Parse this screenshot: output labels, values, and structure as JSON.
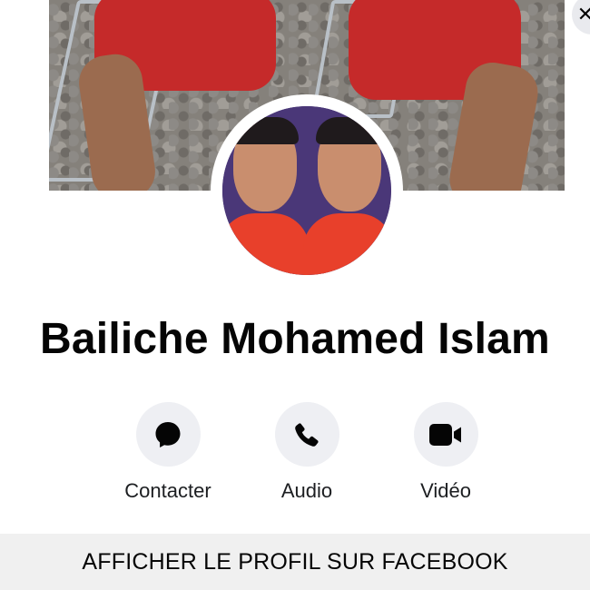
{
  "profile": {
    "name": "Bailiche Mohamed Islam"
  },
  "actions": {
    "contact_label": "Contacter",
    "audio_label": "Audio",
    "video_label": "Vidéo"
  },
  "footer": {
    "view_profile_label": "AFFICHER LE PROFIL SUR FACEBOOK"
  },
  "icons": {
    "contact": "messenger-bubble-icon",
    "audio": "phone-icon",
    "video": "video-camera-icon",
    "close": "close-icon"
  },
  "colors": {
    "icon": "#050505",
    "button_bg": "#eeeff3",
    "footer_bg": "#f0f0f0"
  }
}
